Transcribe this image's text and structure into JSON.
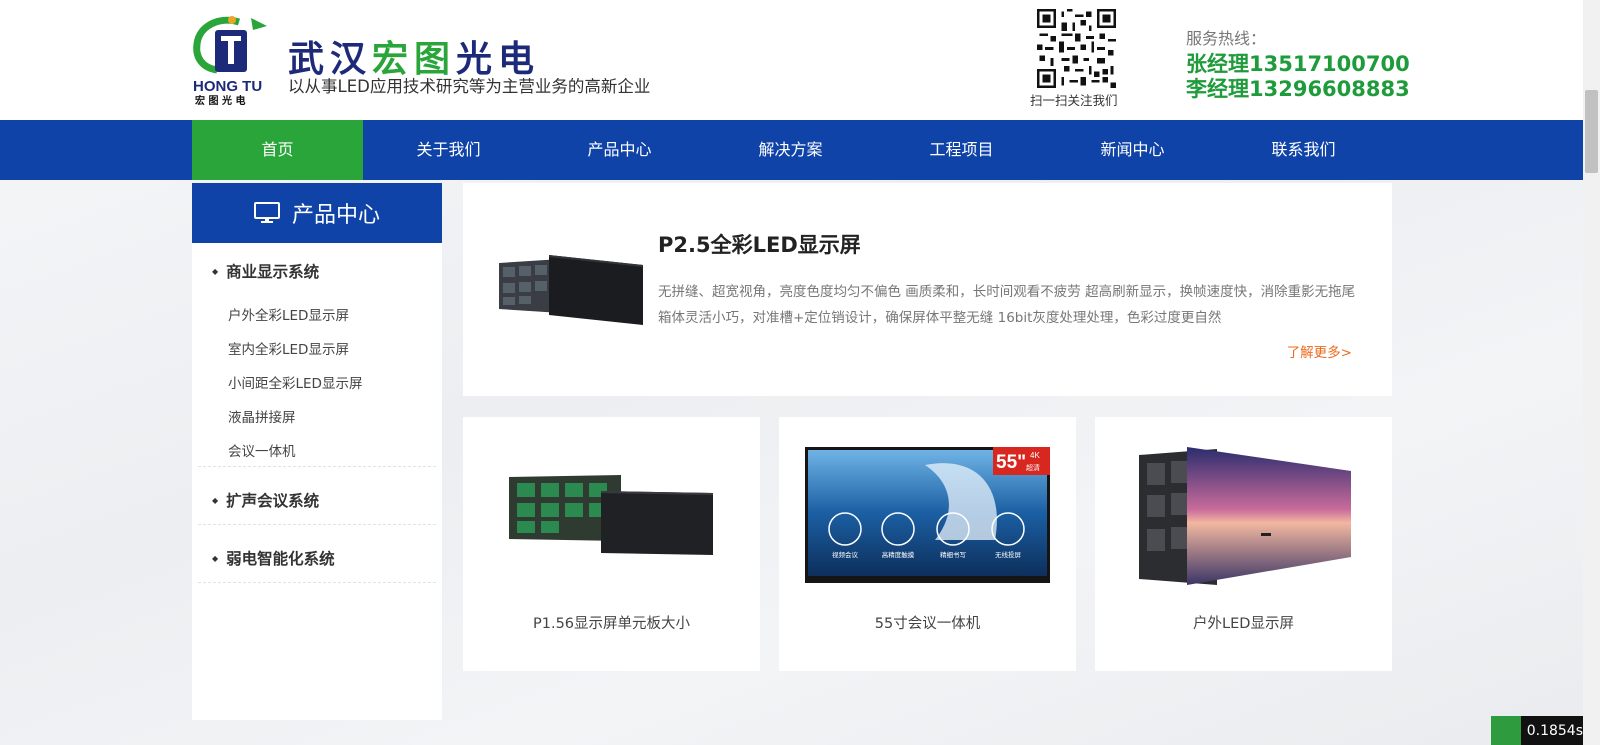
{
  "header": {
    "logo_text": "HONG TU",
    "logo_subtext": "宏 图 光 电",
    "company_name_part1": "武汉",
    "company_name_part2": "宏图",
    "company_name_part3": "光电",
    "slogan": "以从事LED应用技术研究等为主营业务的高新企业",
    "qr_caption": "扫一扫关注我们",
    "hotline_label": "服务热线：",
    "hotline_1": "张经理13517100700",
    "hotline_2": "李经理13296608883"
  },
  "nav": {
    "items": [
      {
        "label": "首页",
        "active": true
      },
      {
        "label": "关于我们"
      },
      {
        "label": "产品中心"
      },
      {
        "label": "解决方案"
      },
      {
        "label": "工程项目"
      },
      {
        "label": "新闻中心"
      },
      {
        "label": "联系我们"
      }
    ]
  },
  "sidebar": {
    "title": "产品中心",
    "categories": [
      {
        "label": "商业显示系统",
        "items": [
          "户外全彩LED显示屏",
          "室内全彩LED显示屏",
          "小间距全彩LED显示屏",
          "液晶拼接屏",
          "会议一体机"
        ]
      },
      {
        "label": "扩声会议系统"
      },
      {
        "label": "弱电智能化系统"
      }
    ]
  },
  "featured": {
    "title": "P2.5全彩LED显示屏",
    "description": "无拼缝、超宽视角，亮度色度均匀不偏色 画质柔和，长时间观看不疲劳 超高刷新显示，换帧速度快，消除重影无拖尾 箱体灵活小巧，对准槽+定位销设计，确保屏体平整无缝 16bit灰度处理处理，色彩过度更自然",
    "more_label": "了解更多>"
  },
  "products": [
    {
      "label": "P1.56显示屏单元板大小"
    },
    {
      "label": "55寸会议一体机",
      "badge": "55\"",
      "badge_sub_top": "4K",
      "badge_sub": "超清",
      "icons": [
        "视频会议",
        "高精度触摸",
        "精细书写",
        "无线投屏"
      ]
    },
    {
      "label": "户外LED显示屏"
    }
  ],
  "perf_badge": "0.1854s",
  "colors": {
    "nav_blue": "#0f43a8",
    "accent_green": "#2aa53a",
    "hotline_green": "#1e9b3a",
    "more_orange": "#ee6a1f"
  }
}
